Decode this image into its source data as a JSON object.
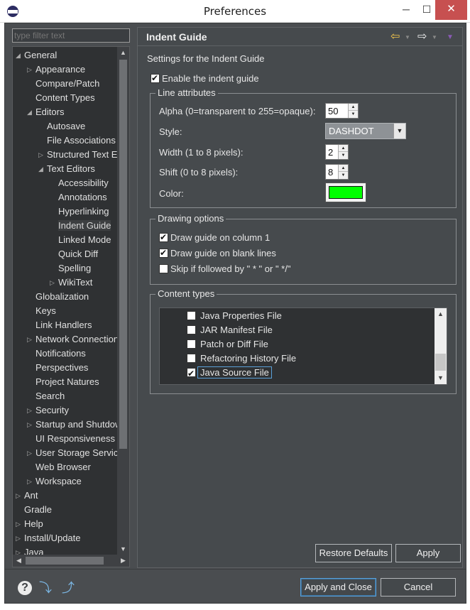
{
  "window": {
    "title": "Preferences",
    "min": "─",
    "max": "☐",
    "close": "✕"
  },
  "filter": {
    "placeholder": "type filter text"
  },
  "tree": {
    "items": [
      {
        "label": "General",
        "twisty": "◢"
      },
      {
        "label": "Appearance",
        "twisty": "▷"
      },
      {
        "label": "Compare/Patch",
        "twisty": ""
      },
      {
        "label": "Content Types",
        "twisty": ""
      },
      {
        "label": "Editors",
        "twisty": "◢"
      },
      {
        "label": "Autosave",
        "twisty": ""
      },
      {
        "label": "File Associations",
        "twisty": ""
      },
      {
        "label": "Structured Text Editors",
        "twisty": "▷"
      },
      {
        "label": "Text Editors",
        "twisty": "◢"
      },
      {
        "label": "Accessibility",
        "twisty": ""
      },
      {
        "label": "Annotations",
        "twisty": ""
      },
      {
        "label": "Hyperlinking",
        "twisty": ""
      },
      {
        "label": "Indent Guide",
        "twisty": ""
      },
      {
        "label": "Linked Mode",
        "twisty": ""
      },
      {
        "label": "Quick Diff",
        "twisty": ""
      },
      {
        "label": "Spelling",
        "twisty": ""
      },
      {
        "label": "WikiText",
        "twisty": "▷"
      },
      {
        "label": "Globalization",
        "twisty": ""
      },
      {
        "label": "Keys",
        "twisty": ""
      },
      {
        "label": "Link Handlers",
        "twisty": ""
      },
      {
        "label": "Network Connections",
        "twisty": "▷"
      },
      {
        "label": "Notifications",
        "twisty": ""
      },
      {
        "label": "Perspectives",
        "twisty": ""
      },
      {
        "label": "Project Natures",
        "twisty": ""
      },
      {
        "label": "Search",
        "twisty": ""
      },
      {
        "label": "Security",
        "twisty": "▷"
      },
      {
        "label": "Startup and Shutdown",
        "twisty": "▷"
      },
      {
        "label": "UI Responsiveness",
        "twisty": ""
      },
      {
        "label": "User Storage Service",
        "twisty": "▷"
      },
      {
        "label": "Web Browser",
        "twisty": ""
      },
      {
        "label": "Workspace",
        "twisty": "▷"
      },
      {
        "label": "Ant",
        "twisty": "▷"
      },
      {
        "label": "Gradle",
        "twisty": ""
      },
      {
        "label": "Help",
        "twisty": "▷"
      },
      {
        "label": "Install/Update",
        "twisty": "▷"
      },
      {
        "label": "Java",
        "twisty": "▷"
      }
    ],
    "selected": "Indent Guide"
  },
  "page": {
    "title": "Indent Guide",
    "nav_back": "⇦",
    "nav_forward": "⇨",
    "nav_dropdown": "▼",
    "settings_label": "Settings for the Indent Guide",
    "enable_label": "Enable the indent guide",
    "enable_checked": true
  },
  "line_attributes": {
    "title": "Line attributes",
    "alpha_label": "Alpha (0=transparent to 255=opaque):",
    "alpha_value": "50",
    "style_label": "Style:",
    "style_value": "DASHDOT",
    "width_label": "Width (1 to 8 pixels):",
    "width_value": "2",
    "shift_label": "Shift (0 to 8 pixels):",
    "shift_value": "8",
    "color_label": "Color:",
    "color_value": "#00ff00"
  },
  "drawing_options": {
    "title": "Drawing options",
    "options": [
      {
        "label": "Draw guide on column 1",
        "checked": true
      },
      {
        "label": "Draw guide on blank lines",
        "checked": true
      },
      {
        "label": "Skip if followed by \" * \" or \" */\"",
        "checked": false
      }
    ]
  },
  "content_types": {
    "title": "Content types",
    "items": [
      {
        "label": "Java Properties File",
        "checked": false
      },
      {
        "label": "JAR Manifest File",
        "checked": false
      },
      {
        "label": "Patch or Diff File",
        "checked": false
      },
      {
        "label": "Refactoring History File",
        "checked": false
      },
      {
        "label": "Java Source File",
        "checked": true
      }
    ]
  },
  "buttons": {
    "restore_defaults": "Restore Defaults",
    "apply": "Apply",
    "apply_and_close": "Apply and Close",
    "cancel": "Cancel"
  },
  "footer": {
    "help": "?",
    "import": "⤵",
    "export": "⤴"
  },
  "colors": {
    "background": "#4a4d50",
    "accent": "#5aa0d8",
    "indent_color": "#00ff00"
  }
}
